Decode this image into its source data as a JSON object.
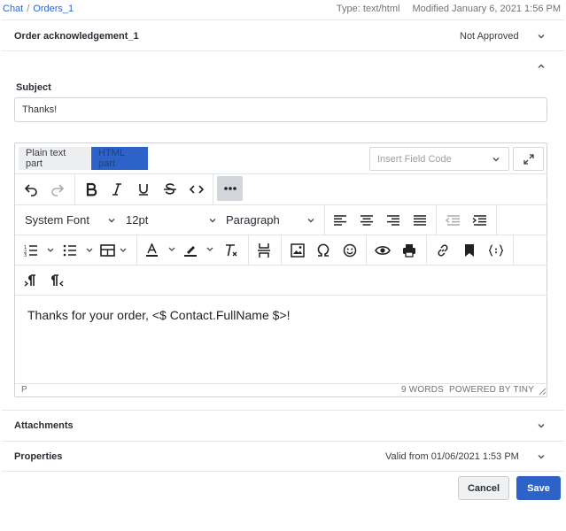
{
  "breadcrumb": {
    "root": "Chat",
    "separator": "/",
    "current": "Orders_1"
  },
  "meta": {
    "type": "Type: text/html",
    "modified": "Modified January 6, 2021 1:56 PM"
  },
  "template": {
    "name": "Order acknowledgement_1",
    "status": "Not Approved"
  },
  "subject": {
    "label": "Subject",
    "value": "Thanks!"
  },
  "editor": {
    "tabs": {
      "plain": "Plain text part",
      "html": "HTML part"
    },
    "insert_field_placeholder": "Insert Field Code",
    "font_family": "System Font",
    "font_size": "12pt",
    "block_format": "Paragraph",
    "content": "Thanks for your order, <$ Contact.FullName $>!",
    "status_path": "P",
    "word_count": "9 WORDS",
    "powered_by": "POWERED BY TINY"
  },
  "sections": {
    "attachments": "Attachments",
    "properties": "Properties",
    "valid_from": "Valid from 01/06/2021 1:53 PM"
  },
  "actions": {
    "cancel": "Cancel",
    "save": "Save"
  },
  "colors": {
    "accent": "#2d63c8",
    "link": "#2a67c9",
    "border": "#cfd3d8"
  }
}
